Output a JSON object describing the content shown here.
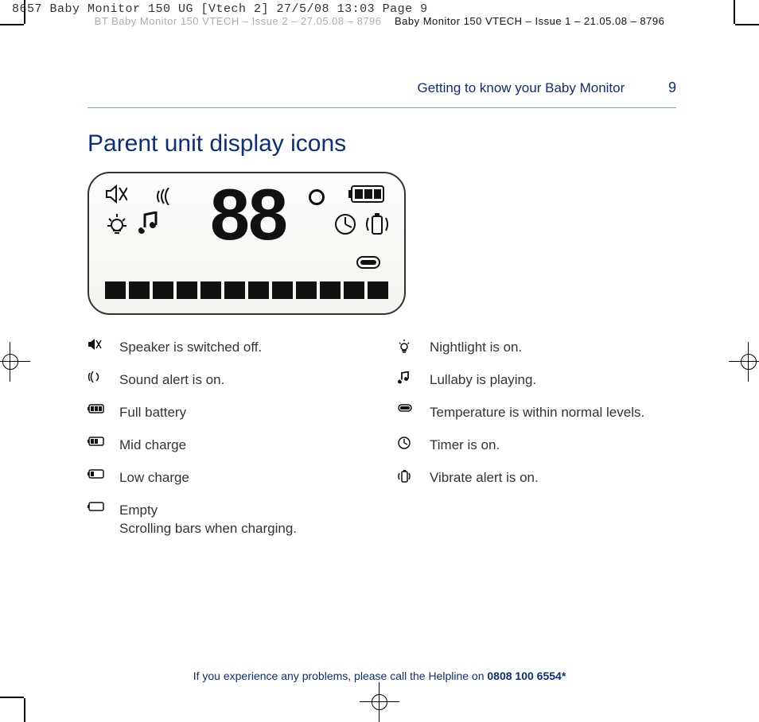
{
  "header": {
    "line1": "8657 Baby Monitor 150 UG [Vtech 2]  27/5/08  13:03  Page 9",
    "line2_left": "BT Baby Monitor 150 VTECH – Issue 2 – 27.05.08 – 8796",
    "line2_right": "Baby Monitor 150 VTECH – Issue 1 – 21.05.08 – 8796"
  },
  "running_head": {
    "title": "Getting to know your Baby Monitor",
    "page_number": "9"
  },
  "section_title": "Parent unit display icons",
  "lcd": {
    "digits": "88",
    "degree": true,
    "bars": 12
  },
  "legend_left": [
    {
      "icon": "speaker-off-icon",
      "text": "Speaker is switched off."
    },
    {
      "icon": "sound-alert-icon",
      "text": "Sound alert is on."
    },
    {
      "icon": "battery-full-icon",
      "text": "Full battery"
    },
    {
      "icon": "battery-mid-icon",
      "text": "Mid charge"
    },
    {
      "icon": "battery-low-icon",
      "text": "Low charge"
    },
    {
      "icon": "battery-empty-icon",
      "text": "Empty\nScrolling bars when charging."
    }
  ],
  "legend_right": [
    {
      "icon": "nightlight-icon",
      "text": "Nightlight is on."
    },
    {
      "icon": "lullaby-icon",
      "text": "Lullaby is playing."
    },
    {
      "icon": "temperature-ok-icon",
      "text": "Temperature is within normal levels."
    },
    {
      "icon": "timer-icon",
      "text": "Timer is on."
    },
    {
      "icon": "vibrate-icon",
      "text": "Vibrate alert is on."
    }
  ],
  "footer": {
    "prefix": "If you experience any problems, please call the Helpline on ",
    "bold": "0808 100 6554*"
  }
}
